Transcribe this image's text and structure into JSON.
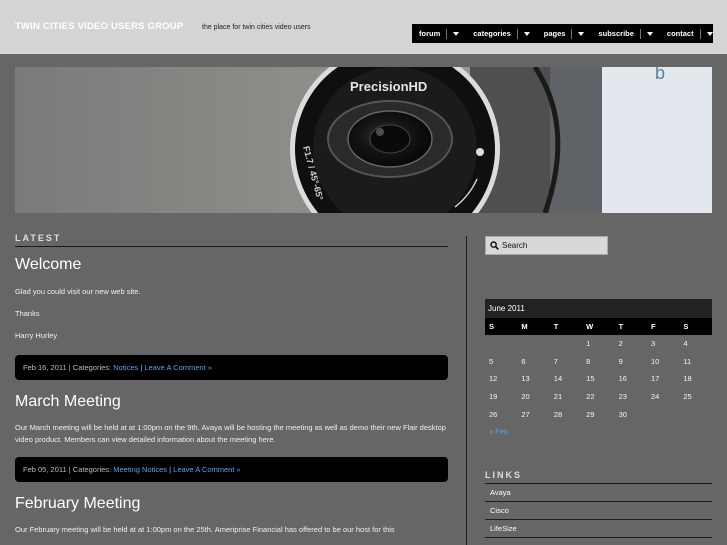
{
  "header": {
    "site_title": "TWIN CITIES VIDEO USERS GROUP",
    "tagline": "the place for twin cities video users"
  },
  "nav": [
    {
      "label": "forum"
    },
    {
      "label": "categories"
    },
    {
      "label": "pages"
    },
    {
      "label": "subscribe"
    },
    {
      "label": "contact"
    }
  ],
  "banner": {
    "camera_brand": "PrecisionHD",
    "lens_text": "F1.7 / 45°-65°"
  },
  "content": {
    "section_title": "LATEST",
    "posts": [
      {
        "title": "Welcome",
        "body": [
          "Glad you could visit our new web site.",
          "Thanks",
          "Harry Hurley"
        ],
        "date": "Feb 16, 2011",
        "categories_label": "| Categories:",
        "category": "Notices",
        "sep": "|",
        "comment": "Leave A Comment »"
      },
      {
        "title": "March Meeting",
        "body": [
          "Our March meeting will be held at at 1:00pm on the 9th.  Avaya will be hosting the meeting as well as demo their new Flair desktop video product. Members can view detailed information about the meeting here."
        ],
        "date": "Feb 05, 2011",
        "categories_label": "| Categories:",
        "category": "Meeting Notices",
        "sep": "|",
        "comment": "Leave A Comment »"
      },
      {
        "title": "February Meeting",
        "body": [
          "Our February meeting will be held at at 1:00pm on the 25th.  Ameriprise Financial has offered to be our host for this"
        ]
      }
    ]
  },
  "sidebar": {
    "search_placeholder": "Search",
    "calendar": {
      "caption": "June 2011",
      "weekdays": [
        "S",
        "M",
        "T",
        "W",
        "T",
        "F",
        "S"
      ],
      "weeks": [
        [
          "",
          "",
          "",
          "1",
          "2",
          "3",
          "4"
        ],
        [
          "5",
          "6",
          "7",
          "8",
          "9",
          "10",
          "11"
        ],
        [
          "12",
          "13",
          "14",
          "15",
          "16",
          "17",
          "18"
        ],
        [
          "19",
          "20",
          "21",
          "22",
          "23",
          "24",
          "25"
        ],
        [
          "26",
          "27",
          "28",
          "29",
          "30",
          "",
          ""
        ]
      ],
      "prev_label": "« Feb"
    },
    "links_title": "LINKS",
    "links": [
      "Avaya",
      "Cisco",
      "LifeSize"
    ]
  },
  "colors": {
    "background": "#666666",
    "header": "#d4d4d4",
    "link": "#5aa2ea",
    "bar": "#000000"
  }
}
